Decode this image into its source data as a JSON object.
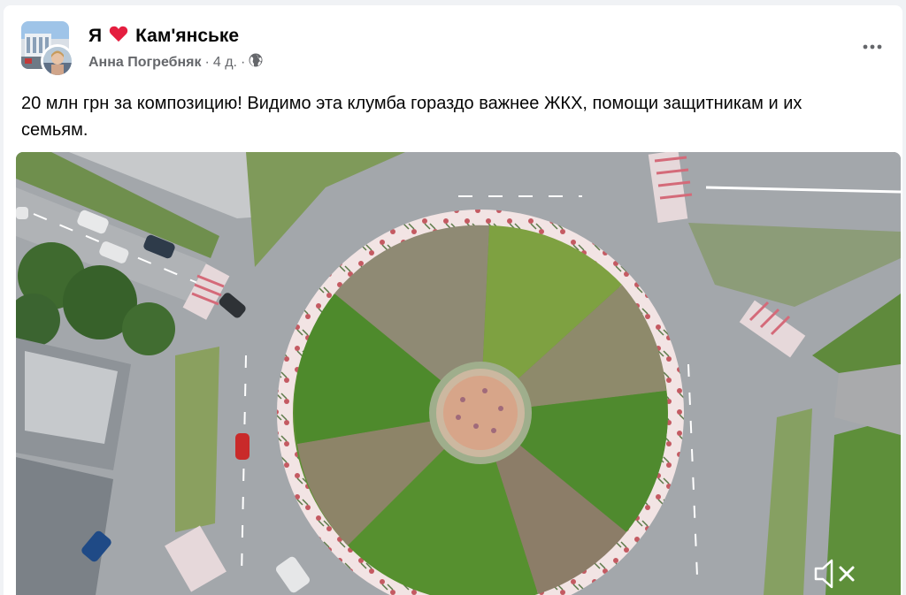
{
  "post": {
    "group_name": "Кам'янське",
    "group_name_prefix": "Я",
    "author": "Анна Погребняк",
    "separator_1": "·",
    "time": "4 д.",
    "separator_2": "·",
    "text": "20 млн грн за композицию! Видимо эта клумба гораздо важнее ЖКХ, помощи защитникам и их семьям."
  },
  "icons": {
    "heart": "heart-icon",
    "globe": "globe-icon",
    "more": "more-dots-icon",
    "muted": "speaker-muted-icon"
  },
  "colors": {
    "heart": "#e41e3f",
    "text": "#050505",
    "secondary": "#65676b",
    "background": "#f0f2f5"
  }
}
